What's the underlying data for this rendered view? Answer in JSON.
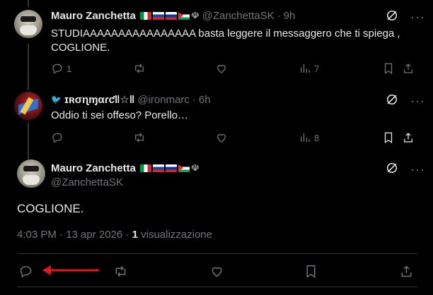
{
  "tweet1": {
    "name": "Mauro Zanchetta",
    "handle": "@ZanchettaSK",
    "time": "9h",
    "text_line1": "STUDIAAAAAAAAAAAAAAAA  basta leggere il messaggero che ti spiega ,",
    "text_line2": "COGLIONE.",
    "replies": "1",
    "views": "7"
  },
  "tweet2": {
    "name": "ɪʀσɳɱαɾƈ‖☆‖",
    "handle": "@ironmarc",
    "time": "6h",
    "text": "Oddio ti sei offeso? Porello…",
    "views": "8"
  },
  "main_tweet": {
    "name": "Mauro Zanchetta",
    "handle": "@ZanchettaSK",
    "text": "COGLIONE.",
    "timestamp": "4:03 PM · 13 apr 2026 · ",
    "views_count": "1",
    "views_label": " visualizzazione"
  },
  "separator_dot": "·",
  "more_glyph": "···",
  "icons": [
    "reply-icon",
    "retweet-icon",
    "like-icon",
    "views-icon",
    "bookmark-icon",
    "share-icon",
    "grok-icon",
    "more-icon",
    "verified-bird-icon",
    "arrow-annotation"
  ],
  "colors": {
    "background": "#000000",
    "text": "#e7e9ea",
    "muted": "#71767b",
    "divider": "#2f3336",
    "annotation": "#e0191f"
  }
}
